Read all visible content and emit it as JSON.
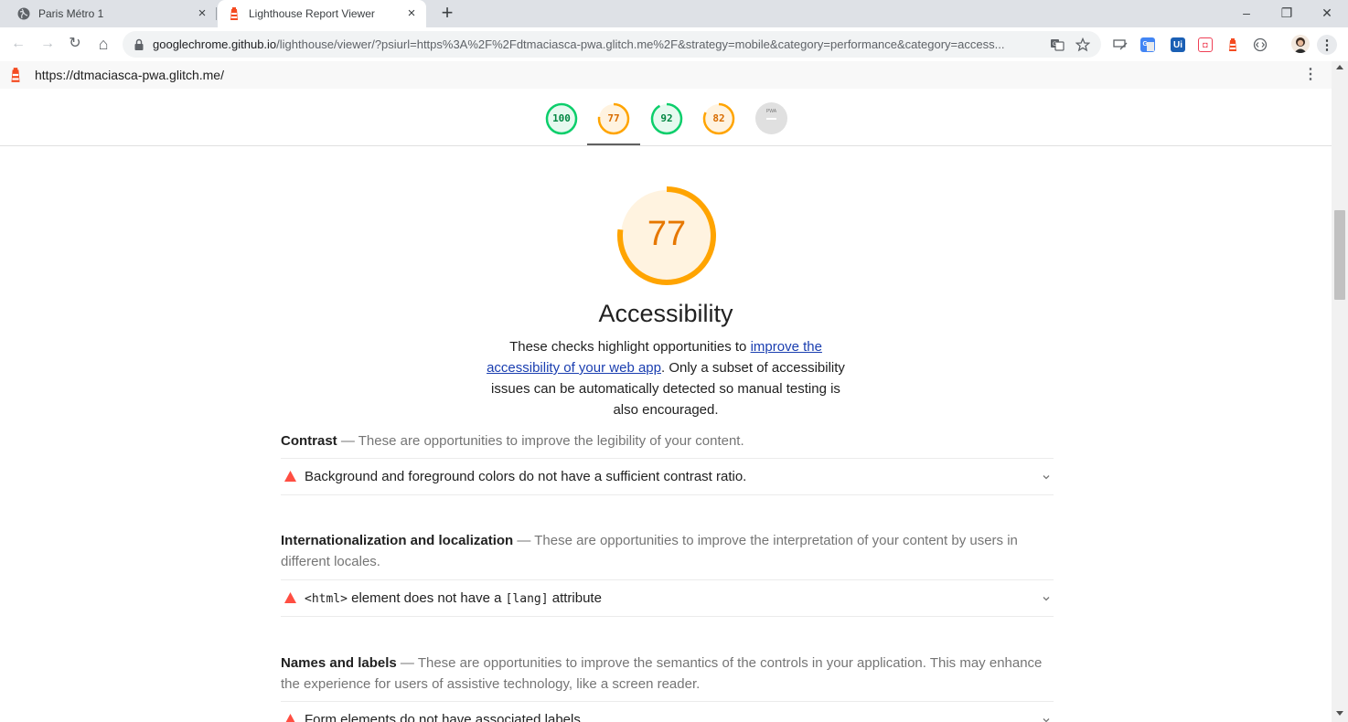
{
  "browser": {
    "tabs": [
      {
        "title": "Paris Métro 1",
        "active": false,
        "favicon": "globe-icon"
      },
      {
        "title": "Lighthouse Report Viewer",
        "active": true,
        "favicon": "lighthouse-icon"
      }
    ],
    "close_glyph": "×",
    "new_tab_glyph": "+",
    "window_controls": {
      "minimize": "–",
      "restore": "❐",
      "close": "✕"
    },
    "nav": {
      "back": "←",
      "forward": "→",
      "reload": "↻",
      "home": "⌂"
    },
    "address": {
      "host": "googlechrome.github.io",
      "path": "/lighthouse/viewer/?psiurl=https%3A%2F%2Fdtmaciasca-pwa.glitch.me%2F&strategy=mobile&category=performance&category=access..."
    },
    "extensions": [
      "translate-icon",
      "bookmark-star-icon",
      "cast-icon",
      "google-translate-icon",
      "ui-extension-icon",
      "pocket-icon",
      "lighthouse-icon",
      "code-icon",
      "profile-avatar",
      "chrome-menu-icon"
    ],
    "ext_labels": {
      "ui": "Ui",
      "pocket": "◘"
    }
  },
  "report": {
    "url": "https://dtmaciasca-pwa.glitch.me/",
    "menu_glyph": "⋮",
    "gauges": [
      {
        "value": "100",
        "score": 100,
        "color": "#0cce6b",
        "active": false
      },
      {
        "value": "77",
        "score": 77,
        "color": "#ffa400",
        "active": true
      },
      {
        "value": "92",
        "score": 92,
        "color": "#0cce6b",
        "active": false
      },
      {
        "value": "82",
        "score": 82,
        "color": "#ffa400",
        "active": false
      }
    ],
    "pwa_label": "PWA",
    "category": {
      "score": "77",
      "score_fraction": 0.77,
      "title": "Accessibility",
      "desc_before": "These checks highlight opportunities to ",
      "desc_link": "improve the accessibility of your web app",
      "desc_after": ". Only a subset of accessibility issues can be automatically detected so manual testing is also encouraged."
    },
    "groups": [
      {
        "title": "Contrast",
        "separator": " — ",
        "desc": "These are opportunities to improve the legibility of your content.",
        "audit": "Background and foreground colors do not have a sufficient contrast ratio."
      },
      {
        "title": "Internationalization and localization",
        "separator": " — ",
        "desc": "These are opportunities to improve the interpretation of your content by users in different locales.",
        "audit_code1": "<html>",
        "audit_mid": " element does not have a ",
        "audit_code2": "[lang]",
        "audit_end": " attribute"
      },
      {
        "title": "Names and labels",
        "separator": " — ",
        "desc": "These are opportunities to improve the semantics of the controls in your application. This may enhance the experience for users of assistive technology, like a screen reader.",
        "audit": "Form elements do not have associated labels"
      }
    ]
  },
  "colors": {
    "pass": "#0cce6b",
    "average": "#ffa400",
    "fail": "#ff4e42",
    "link": "#1a3eb0"
  }
}
